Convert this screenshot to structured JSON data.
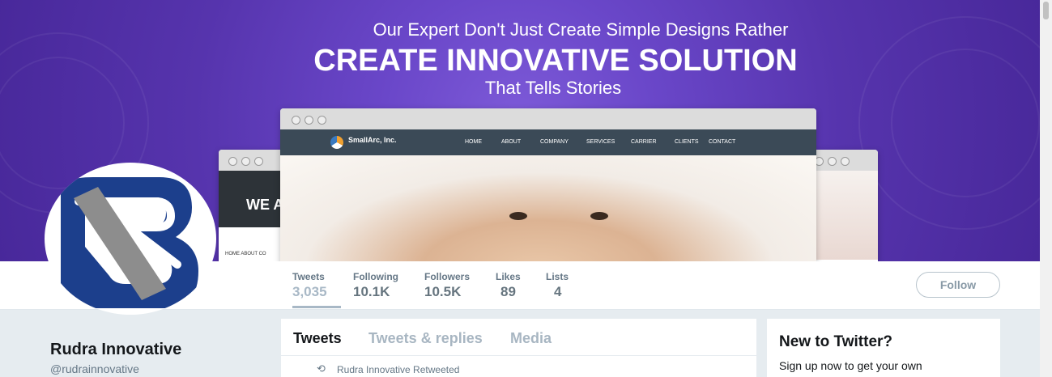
{
  "banner": {
    "line1": "Our Expert Don't Just Create Simple Designs Rather",
    "line2": "CREATE INNOVATIVE SOLUTION",
    "line3": "That Tells Stories",
    "mockup": {
      "logo_text": "SmallArc, Inc.",
      "nav": [
        "HOME",
        "ABOUT",
        "COMPANY",
        "SERVICES",
        "CARRIER",
        "CLIENTS",
        "CONTACT"
      ],
      "left_heading": "WE A",
      "left_nav": "HOME   ABOUT   CO"
    }
  },
  "stats": [
    {
      "label": "Tweets",
      "value": "3,035"
    },
    {
      "label": "Following",
      "value": "10.1K"
    },
    {
      "label": "Followers",
      "value": "10.5K"
    },
    {
      "label": "Likes",
      "value": "89"
    },
    {
      "label": "Lists",
      "value": "4"
    }
  ],
  "follow_label": "Follow",
  "profile": {
    "name": "Rudra Innovative",
    "handle": "@rudrainnovative"
  },
  "timeline": {
    "tabs": [
      "Tweets",
      "Tweets & replies",
      "Media"
    ],
    "retweet_text": "Rudra Innovative Retweeted"
  },
  "sidebar": {
    "title": "New to Twitter?",
    "text": "Sign up now to get your own"
  },
  "colors": {
    "banner": "#5a36b4",
    "logo_blue": "#1c3f8c",
    "logo_gray": "#8d8d8d"
  }
}
